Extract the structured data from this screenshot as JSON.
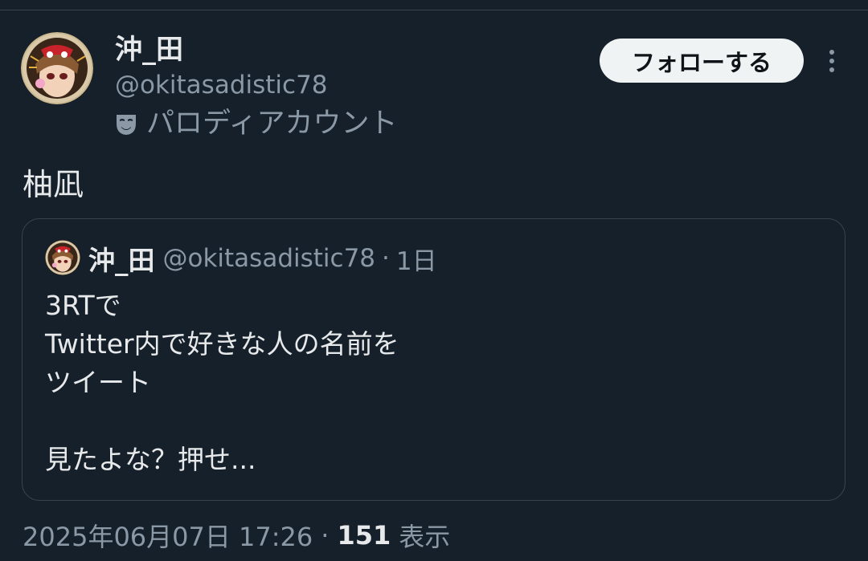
{
  "author": {
    "display_name": "沖_田",
    "handle": "@okitasadistic78",
    "parody_label": "パロディアカウント",
    "parody_icon": "theater-mask-icon"
  },
  "actions": {
    "follow_label": "フォローする",
    "more_icon": "more-vertical-icon"
  },
  "tweet": {
    "text": "柚凪"
  },
  "quoted_tweet": {
    "display_name": "沖_田",
    "handle": "@okitasadistic78",
    "dot": "·",
    "time": "1日",
    "lines": [
      "3RTで",
      "Twitter内で好きな人の名前を",
      "ツイート",
      "",
      "見たよな？押せ..."
    ]
  },
  "meta": {
    "timestamp": "2025年06月07日 17:26",
    "separator": "·",
    "views_count": "151",
    "views_label": "表示"
  },
  "colors": {
    "background": "#15202b",
    "text_primary": "#e7e9ea",
    "text_secondary": "#8b98a5",
    "border": "#38444d",
    "follow_button_bg": "#eff3f4"
  }
}
